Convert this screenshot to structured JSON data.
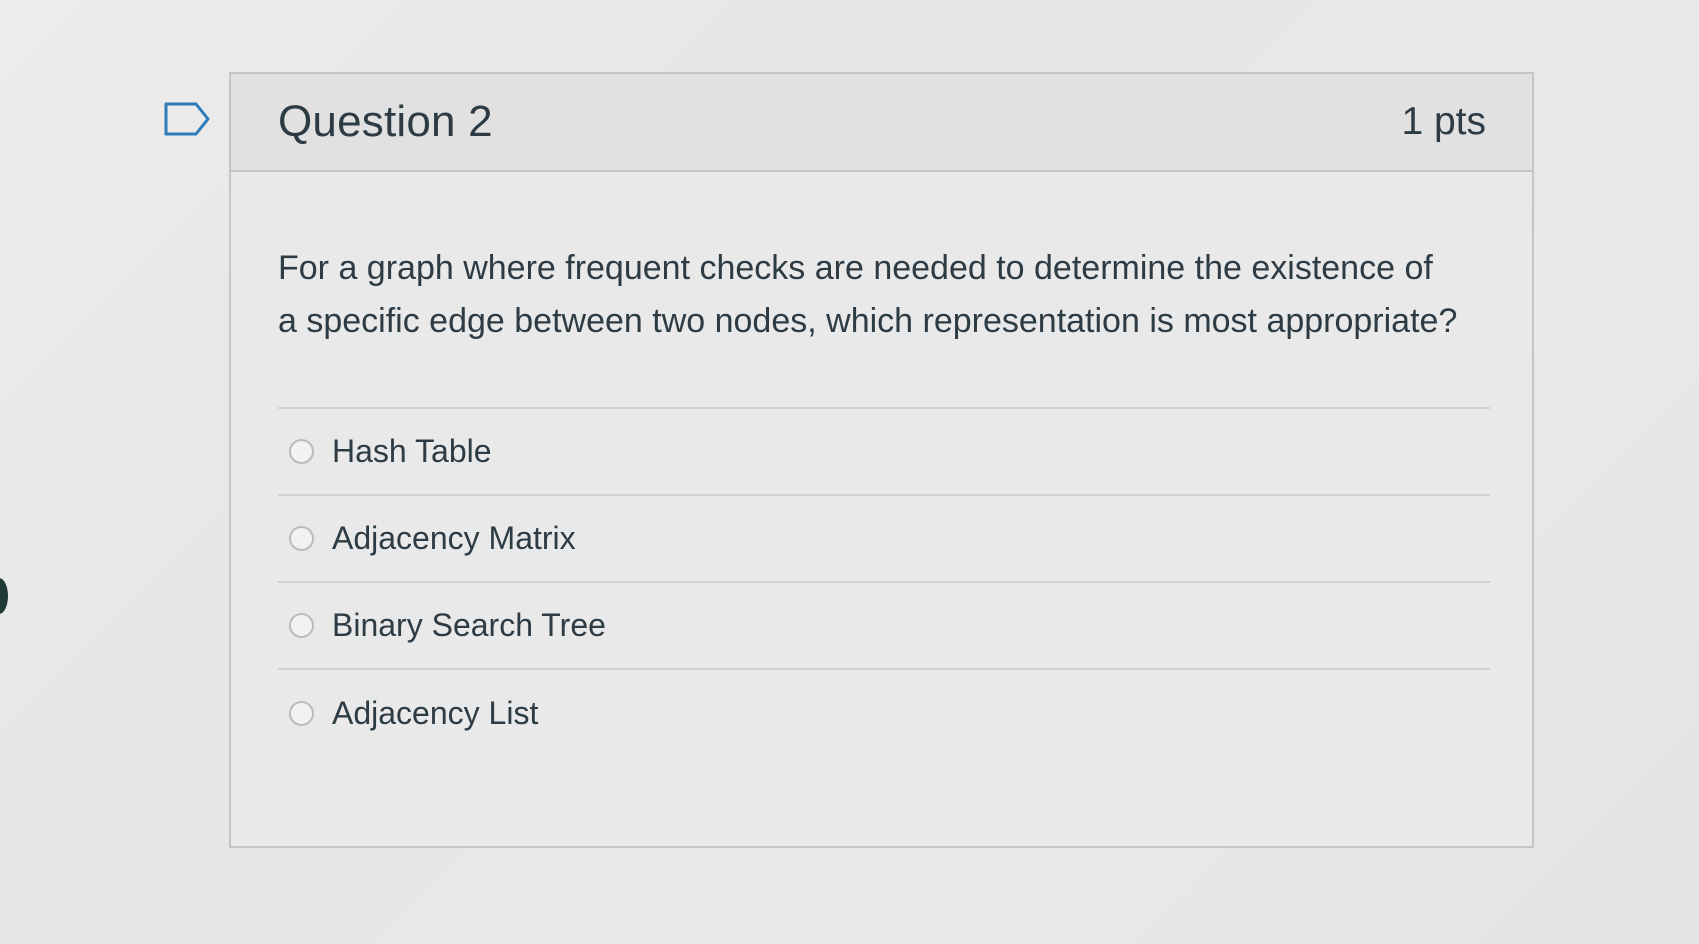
{
  "question": {
    "title": "Question 2",
    "points": "1 pts",
    "text": "For a graph where frequent checks are needed to determine the existence of a specific edge between two nodes, which representation is most appropriate?",
    "answers": [
      {
        "label": "Hash Table",
        "selected": false
      },
      {
        "label": "Adjacency Matrix",
        "selected": false
      },
      {
        "label": "Binary Search Tree",
        "selected": false
      },
      {
        "label": "Adjacency List",
        "selected": false
      }
    ]
  },
  "icons": {
    "flag": "flag-question-icon",
    "radio": "radio-button-icon"
  },
  "colors": {
    "text": "#2d3b45",
    "header_bg": "#e1e1e1",
    "border": "#c3c5c7",
    "flag_outline": "#2d7bb8"
  }
}
